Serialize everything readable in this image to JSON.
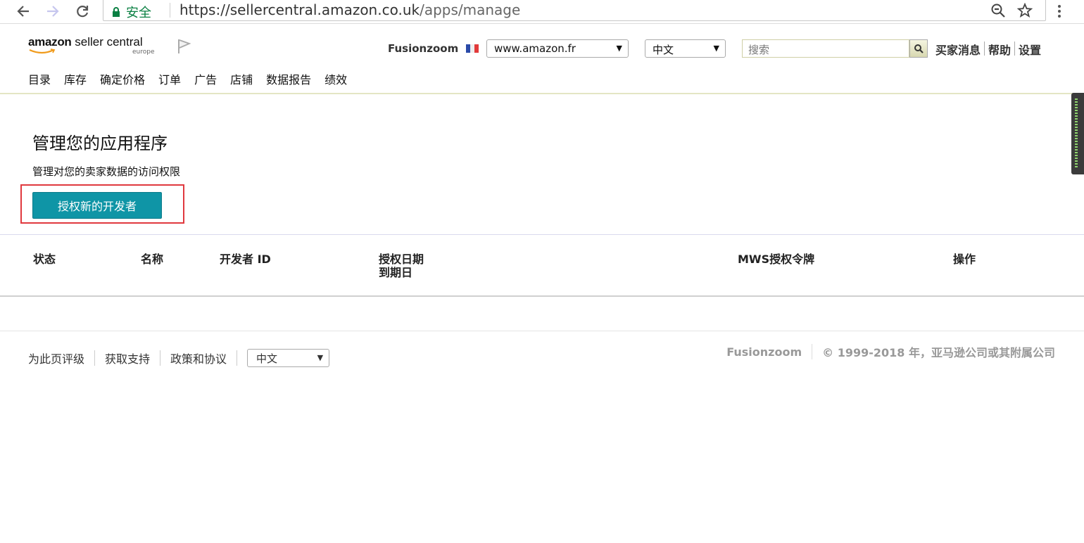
{
  "browser": {
    "security_label": "安全",
    "url_host": "https://sellercentral.amazon.co.uk",
    "url_path": "/apps/manage"
  },
  "header": {
    "logo_amazon": "amazon",
    "logo_product": "seller central",
    "logo_region": "europe",
    "account_name": "Fusionzoom",
    "marketplace_selected": "www.amazon.fr",
    "language_selected": "中文",
    "search_placeholder": "搜索",
    "links": [
      "买家消息",
      "帮助",
      "设置"
    ]
  },
  "nav": {
    "items": [
      "目录",
      "库存",
      "确定价格",
      "订单",
      "广告",
      "店铺",
      "数据报告",
      "绩效"
    ]
  },
  "main": {
    "title": "管理您的应用程序",
    "subtitle": "管理对您的卖家数据的访问权限",
    "authorize_button": "授权新的开发者",
    "columns": {
      "status": "状态",
      "name": "名称",
      "developer_id": "开发者 ID",
      "auth_date": "授权日期",
      "expiry_date": "到期日",
      "mws_token": "MWS授权令牌",
      "action": "操作"
    }
  },
  "footer": {
    "links": [
      "为此页评级",
      "获取支持",
      "政策和协议"
    ],
    "language_selected": "中文",
    "account_name": "Fusionzoom",
    "copyright": "© 1999-2018 年，亚马逊公司或其附属公司"
  },
  "colors": {
    "primary_button": "#0f95a6",
    "highlight_border": "#e0393e",
    "secure_green": "#0b8043"
  }
}
